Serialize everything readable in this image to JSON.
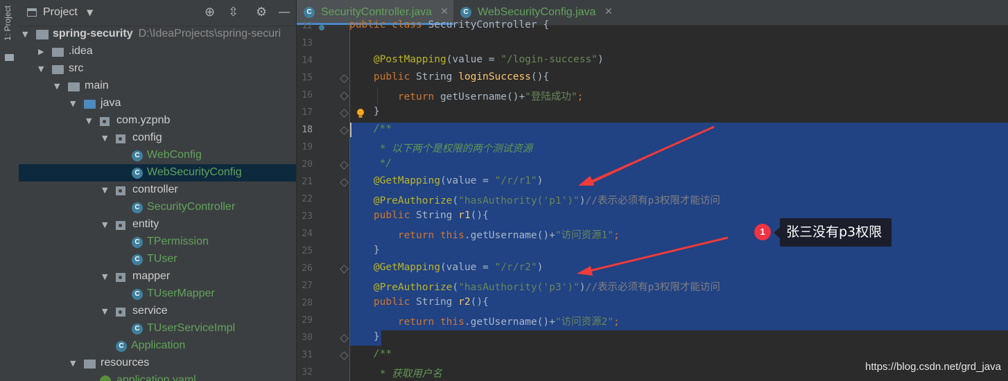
{
  "sidebar_stripe": {
    "tab_label": "1: Project"
  },
  "project_panel": {
    "title": "Project",
    "tree": [
      {
        "label": "spring-security",
        "path": "D:\\IdeaProjects\\spring-securi",
        "type": "module",
        "depth": 0,
        "expanded": true
      },
      {
        "label": ".idea",
        "type": "folder",
        "depth": 1,
        "expanded": false
      },
      {
        "label": "src",
        "type": "folder",
        "depth": 1,
        "expanded": true
      },
      {
        "label": "main",
        "type": "folder",
        "depth": 2,
        "expanded": true
      },
      {
        "label": "java",
        "type": "source-folder",
        "depth": 3,
        "expanded": true
      },
      {
        "label": "com.yzpnb",
        "type": "package",
        "depth": 4,
        "expanded": true
      },
      {
        "label": "config",
        "type": "package",
        "depth": 5,
        "expanded": true
      },
      {
        "label": "WebConfig",
        "type": "class",
        "depth": 6
      },
      {
        "label": "WebSecurityConfig",
        "type": "class",
        "depth": 6,
        "selected": true
      },
      {
        "label": "controller",
        "type": "package",
        "depth": 5,
        "expanded": true
      },
      {
        "label": "SecurityController",
        "type": "class",
        "depth": 6
      },
      {
        "label": "entity",
        "type": "package",
        "depth": 5,
        "expanded": true
      },
      {
        "label": "TPermission",
        "type": "class",
        "depth": 6
      },
      {
        "label": "TUser",
        "type": "class",
        "depth": 6
      },
      {
        "label": "mapper",
        "type": "package",
        "depth": 5,
        "expanded": true
      },
      {
        "label": "TUserMapper",
        "type": "class",
        "depth": 6
      },
      {
        "label": "service",
        "type": "package",
        "depth": 5,
        "expanded": true
      },
      {
        "label": "TUserServiceImpl",
        "type": "class",
        "depth": 6
      },
      {
        "label": "Application",
        "type": "app-class",
        "depth": 5
      },
      {
        "label": "resources",
        "type": "resources",
        "depth": 3,
        "expanded": true
      },
      {
        "label": "application.yaml",
        "type": "yaml",
        "depth": 4
      }
    ]
  },
  "editor": {
    "tabs": [
      {
        "label": "SecurityController.java",
        "active": true
      },
      {
        "label": "WebSecurityConfig.java",
        "active": false
      }
    ],
    "current_line": 18,
    "selection_lines": [
      18,
      30
    ],
    "lines": [
      {
        "n": "12",
        "tokens": [
          [
            "kw",
            "public "
          ],
          [
            "kw",
            "class "
          ],
          [
            "pr",
            "SecurityController {"
          ]
        ]
      },
      {
        "n": "13",
        "tokens": []
      },
      {
        "n": "14",
        "tokens": [
          [
            "pr",
            "    "
          ],
          [
            "an",
            "@PostMapping"
          ],
          [
            "pr",
            "(value = "
          ],
          [
            "st",
            "\"/login-success\""
          ],
          [
            "pr",
            ")"
          ]
        ]
      },
      {
        "n": "15",
        "tokens": [
          [
            "pr",
            "    "
          ],
          [
            "kw",
            "public "
          ],
          [
            "pr",
            "String "
          ],
          [
            "fn",
            "loginSuccess"
          ],
          [
            "pr",
            "(){"
          ]
        ]
      },
      {
        "n": "16",
        "tokens": [
          [
            "pr",
            "        "
          ],
          [
            "kw",
            "return "
          ],
          [
            "pr",
            "getUsername()+"
          ],
          [
            "st",
            "\"登陆成功\""
          ],
          [
            "kw",
            ";"
          ]
        ]
      },
      {
        "n": "17",
        "tokens": [
          [
            "pr",
            "    }"
          ]
        ]
      },
      {
        "n": "18",
        "tokens": [
          [
            "pr",
            "    "
          ],
          [
            "cm",
            "/**"
          ]
        ]
      },
      {
        "n": "19",
        "tokens": [
          [
            "pr",
            "     "
          ],
          [
            "cm",
            "* 以下两个是权限的两个测试资源"
          ]
        ]
      },
      {
        "n": "20",
        "tokens": [
          [
            "pr",
            "     "
          ],
          [
            "cm",
            "*/"
          ]
        ]
      },
      {
        "n": "21",
        "tokens": [
          [
            "pr",
            "    "
          ],
          [
            "an",
            "@GetMapping"
          ],
          [
            "pr",
            "(value = "
          ],
          [
            "st",
            "\"/r/r1\""
          ],
          [
            "pr",
            ")"
          ]
        ]
      },
      {
        "n": "22",
        "tokens": [
          [
            "pr",
            "    "
          ],
          [
            "an",
            "@PreAuthorize"
          ],
          [
            "pr",
            "("
          ],
          [
            "st",
            "\"hasAuthority('p1')\""
          ],
          [
            "pr",
            ")"
          ],
          [
            "lc",
            "//表示必须有p3权限才能访问"
          ]
        ]
      },
      {
        "n": "23",
        "tokens": [
          [
            "pr",
            "    "
          ],
          [
            "kw",
            "public "
          ],
          [
            "pr",
            "String "
          ],
          [
            "fn",
            "r1"
          ],
          [
            "pr",
            "(){"
          ]
        ]
      },
      {
        "n": "24",
        "tokens": [
          [
            "pr",
            "        "
          ],
          [
            "kw",
            "return this"
          ],
          [
            "pr",
            ".getUsername()+"
          ],
          [
            "st",
            "\"访问资源1\""
          ],
          [
            "kw",
            ";"
          ]
        ]
      },
      {
        "n": "25",
        "tokens": [
          [
            "pr",
            "    }"
          ]
        ]
      },
      {
        "n": "26",
        "tokens": [
          [
            "pr",
            "    "
          ],
          [
            "an",
            "@GetMapping"
          ],
          [
            "pr",
            "(value = "
          ],
          [
            "st",
            "\"/r/r2\""
          ],
          [
            "pr",
            ")"
          ]
        ]
      },
      {
        "n": "27",
        "tokens": [
          [
            "pr",
            "    "
          ],
          [
            "an",
            "@PreAuthorize"
          ],
          [
            "pr",
            "("
          ],
          [
            "st",
            "\"hasAuthority('p3')\""
          ],
          [
            "pr",
            ")"
          ],
          [
            "lc",
            "//表示必须有p3权限才能访问"
          ]
        ]
      },
      {
        "n": "28",
        "tokens": [
          [
            "pr",
            "    "
          ],
          [
            "kw",
            "public "
          ],
          [
            "pr",
            "String "
          ],
          [
            "fn",
            "r2"
          ],
          [
            "pr",
            "(){"
          ]
        ]
      },
      {
        "n": "29",
        "tokens": [
          [
            "pr",
            "        "
          ],
          [
            "kw",
            "return this"
          ],
          [
            "pr",
            ".getUsername()+"
          ],
          [
            "st",
            "\"访问资源2\""
          ],
          [
            "kw",
            ";"
          ]
        ]
      },
      {
        "n": "30",
        "tokens": [
          [
            "pr",
            "    }"
          ]
        ]
      },
      {
        "n": "31",
        "tokens": [
          [
            "pr",
            "    "
          ],
          [
            "cm",
            "/**"
          ]
        ]
      },
      {
        "n": "32",
        "tokens": [
          [
            "pr",
            "     "
          ],
          [
            "cm",
            "* 获取用户名"
          ]
        ]
      }
    ]
  },
  "annotation": {
    "badge_number": "1",
    "callout_text": "张三没有p3权限",
    "arrow_color": "#ee3b3b"
  },
  "watermark": "https://blog.csdn.net/grd_java",
  "colors": {
    "keyword": "#cc7832",
    "annotation": "#bbb529",
    "string": "#6a8759",
    "method": "#ffc66d",
    "doc_comment": "#629755",
    "line_comment": "#808080",
    "selection": "#214283",
    "class_name": "#62a35c"
  }
}
